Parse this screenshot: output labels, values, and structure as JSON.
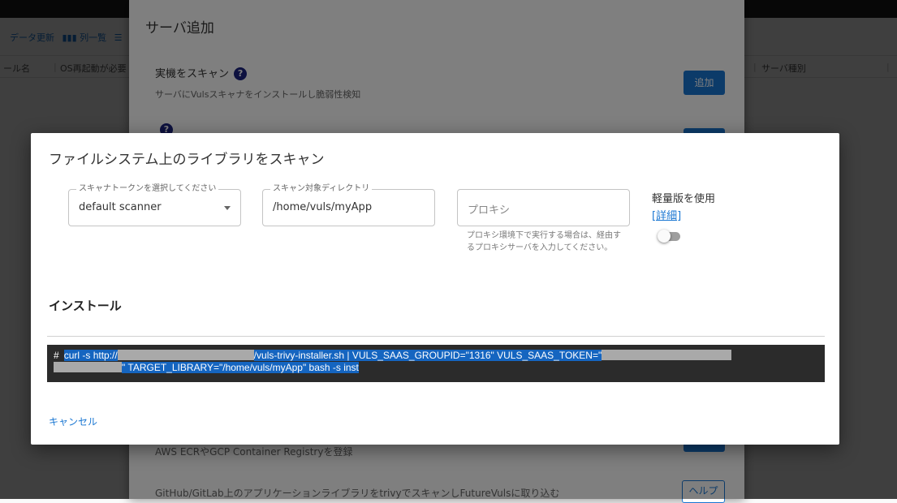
{
  "background": {
    "toolbar": {
      "items": [
        "データ更新",
        "▮▮▮ 列一覧",
        "☰"
      ]
    },
    "table_headers": [
      "ール名",
      "OS再起動が必要",
      "サーバ種別"
    ]
  },
  "add_server_dialog": {
    "title": "サーバ追加",
    "options": [
      {
        "title": "実機をスキャン",
        "help": "?",
        "description": "サーバにVulsスキャナをインストールし脆弱性検知",
        "button": "追加"
      },
      {
        "title": "",
        "help": "?",
        "description": "",
        "button": ""
      },
      {
        "title": "",
        "help": "",
        "description": "AWS ECRやGCP Container Registryを登録",
        "button": ""
      },
      {
        "title": "",
        "help": "",
        "description": "GitHub/GitLab上のアプリケーションライブラリをtrivyでスキャンしFutureVulsに取り込む",
        "button": "ヘルプ"
      }
    ]
  },
  "scan_dialog": {
    "title": "ファイルシステム上のライブラリをスキャン",
    "scanner_token": {
      "label": "スキャナトークンを選択してください",
      "value": "default scanner"
    },
    "target_dir": {
      "label": "スキャン対象ディレクトリ",
      "value": "/home/vuls/myApp"
    },
    "proxy": {
      "placeholder": "プロキシ",
      "help": "プロキシ環境下で実行する場合は、経由するプロキシサーバを入力してください。"
    },
    "lite": {
      "label": "軽量版を使用",
      "detail_link": "[詳細]",
      "enabled": false
    },
    "install_heading": "インストール",
    "command": {
      "prompt": "#",
      "part1": "curl -s http://",
      "part2": "/vuls-trivy-installer.sh | VULS_SAAS_GROUPID=\"1316\" VULS_SAAS_TOKEN=\"",
      "part3": "\" TARGET_LIBRARY=\"/home/vuls/myApp\" bash -s inst"
    },
    "cancel": "キャンセル"
  }
}
